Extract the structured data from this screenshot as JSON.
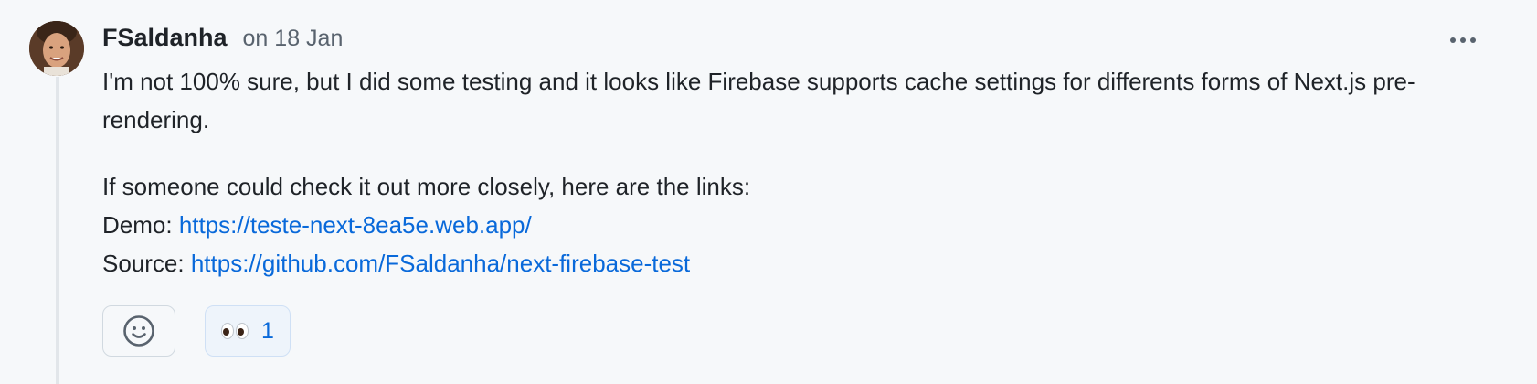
{
  "comment": {
    "author": "FSaldanha",
    "timestamp": "on 18 Jan",
    "paragraph1": "I'm not 100% sure, but I did some testing and it looks like Firebase supports cache settings for differents forms of Next.js pre-rendering.",
    "paragraph2_intro": "If someone could check it out more closely, here are the links:",
    "demo_label": "Demo:",
    "demo_url": "https://teste-next-8ea5e.web.app/",
    "source_label": "Source:",
    "source_url": "https://github.com/FSaldanha/next-firebase-test"
  },
  "reactions": {
    "add_icon": "smiley-icon",
    "items": [
      {
        "emoji": "eyes",
        "count": "1"
      }
    ]
  },
  "menu_icon": "kebab-horizontal-icon",
  "colors": {
    "link": "#0969da",
    "muted": "#59636e",
    "background": "#f6f8fa"
  }
}
